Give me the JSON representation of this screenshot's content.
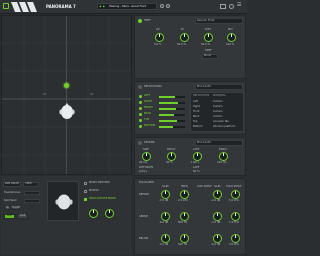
{
  "titlebar": {
    "brand": "PANORAMA 7",
    "preset_name": "Hearing - Hemi...anical Front",
    "arrow_left": "◀",
    "arrow_right": "▶",
    "menu_glyph": "☰"
  },
  "panner": {
    "label_left": "-90",
    "label_right": "90"
  },
  "left_bottom": {
    "dropdown1": "PAN SPACE",
    "dropdown2": "VIEW",
    "row1_label": "Headphones",
    "row2_label": "Spk/Head",
    "btn_a": "BI",
    "btn_b": "FRONT",
    "btn_c": "MID",
    "btn_d": "SIDE",
    "check1": "MONO PREVIEW",
    "check2": "BYPASS",
    "check3": "HEAD ROTATE MODE"
  },
  "hrtf": {
    "title": "HRTF",
    "mode_value": "Generic Front",
    "knob_labels": [
      "AZ",
      "EL",
      "DIST",
      "MIX"
    ],
    "knob_values": [
      "0.0 %",
      "50.0 %",
      "50.0 %",
      "100 %"
    ],
    "sub_label": "HRTF",
    "sub_value": "Mono"
  },
  "reflections": {
    "title": "REFLECTIONS",
    "preset_value": "Mini booth",
    "bands": [
      "LEFT",
      "RIGHT",
      "FRONT",
      "BACK",
      "TOP",
      "BOTTOM"
    ],
    "band_levels": [
      0.6,
      0.72,
      0.66,
      0.58,
      0.68,
      0.55
    ],
    "list_header_a": "REFLECTION",
    "list_header_b": "MATERIAL",
    "list_a": [
      "Left",
      "Right",
      "Front",
      "Back",
      "Top",
      "Bottom"
    ],
    "list_b": [
      "Curtain",
      "Curtain",
      "Curtain",
      "Curtain",
      "Acoustic tile",
      "Wooden platform"
    ]
  },
  "reverb": {
    "title": "REVERB",
    "preset_value": "Mini booth",
    "knob_labels": [
      "SIZE",
      "DECAY",
      "LATE",
      "EARLY",
      "DIFFUSION",
      "LATE"
    ],
    "knob_values": [
      "40 ms",
      "40 %",
      "1.60 s",
      "120 ms",
      "0.04 s",
      "60 %"
    ]
  },
  "equalizer": {
    "title": "EQUALIZER",
    "row_labels": [
      "BEHIND",
      "ABOVE",
      "BELOW"
    ],
    "knob_labels": [
      "GAIN",
      "FREQ",
      "GAIN",
      "FREQ"
    ],
    "knob_values": [
      "-3.5 dB",
      "2.0 kHz",
      "-2.0 dB",
      "5.0 kHz",
      "-6.0 dB",
      "800 Hz",
      "-3.0 dB",
      "1.5 kHz",
      "-2.5 dB",
      "500 Hz",
      "-4.0 dB",
      "4.0 kHz"
    ],
    "side_labels": [
      "LOW SHELF",
      "HIGH SHELF"
    ]
  },
  "colors": {
    "accent": "#6fd22a",
    "bg": "#2b2e31",
    "panel": "#33373a"
  }
}
